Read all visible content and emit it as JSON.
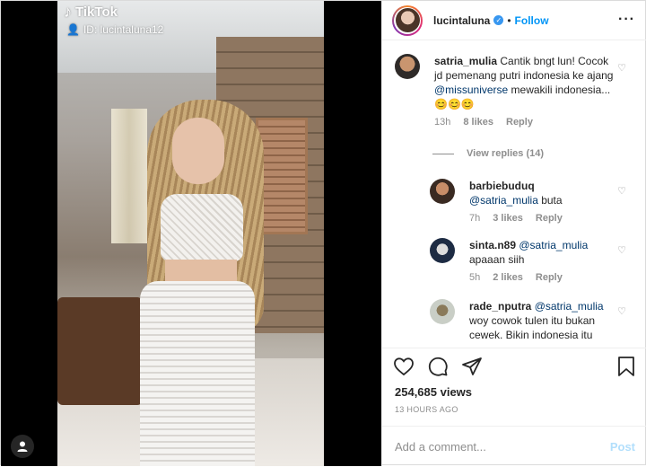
{
  "media": {
    "watermark_app": "TikTok",
    "watermark_id": "ID: lucintaluna12"
  },
  "post": {
    "username": "lucintaluna",
    "follow_label": "Follow",
    "views": "254,685 views",
    "time_ago": "13 HOURS AGO",
    "add_comment_placeholder": "Add a comment...",
    "post_label": "Post"
  },
  "comments": [
    {
      "user": "satria_mulia",
      "text_before": "Cantik bngt lun! Cocok jd pemenang putri indonesia ke ajang ",
      "mention": "@missuniverse",
      "text_after": " mewakili indonesia... 😊😊😊",
      "time": "13h",
      "likes": "8 likes",
      "reply": "Reply"
    },
    {
      "user": "barbiebuduq",
      "mention": "@satria_mulia",
      "text_after": " buta",
      "time": "7h",
      "likes": "3 likes",
      "reply": "Reply"
    },
    {
      "user": "sinta.n89",
      "mention": "@satria_mulia",
      "text_after": " apaaan siih",
      "time": "5h",
      "likes": "2 likes",
      "reply": "Reply"
    },
    {
      "user": "rade_nputra",
      "mention": "@satria_mulia",
      "text_after": " woy cowok tulen itu bukan cewek. Bikin indonesia itu"
    }
  ],
  "view_replies": "View replies (14)",
  "colors": {
    "link": "#0095f6",
    "mention": "#00376b",
    "muted": "#8e8e8e"
  }
}
